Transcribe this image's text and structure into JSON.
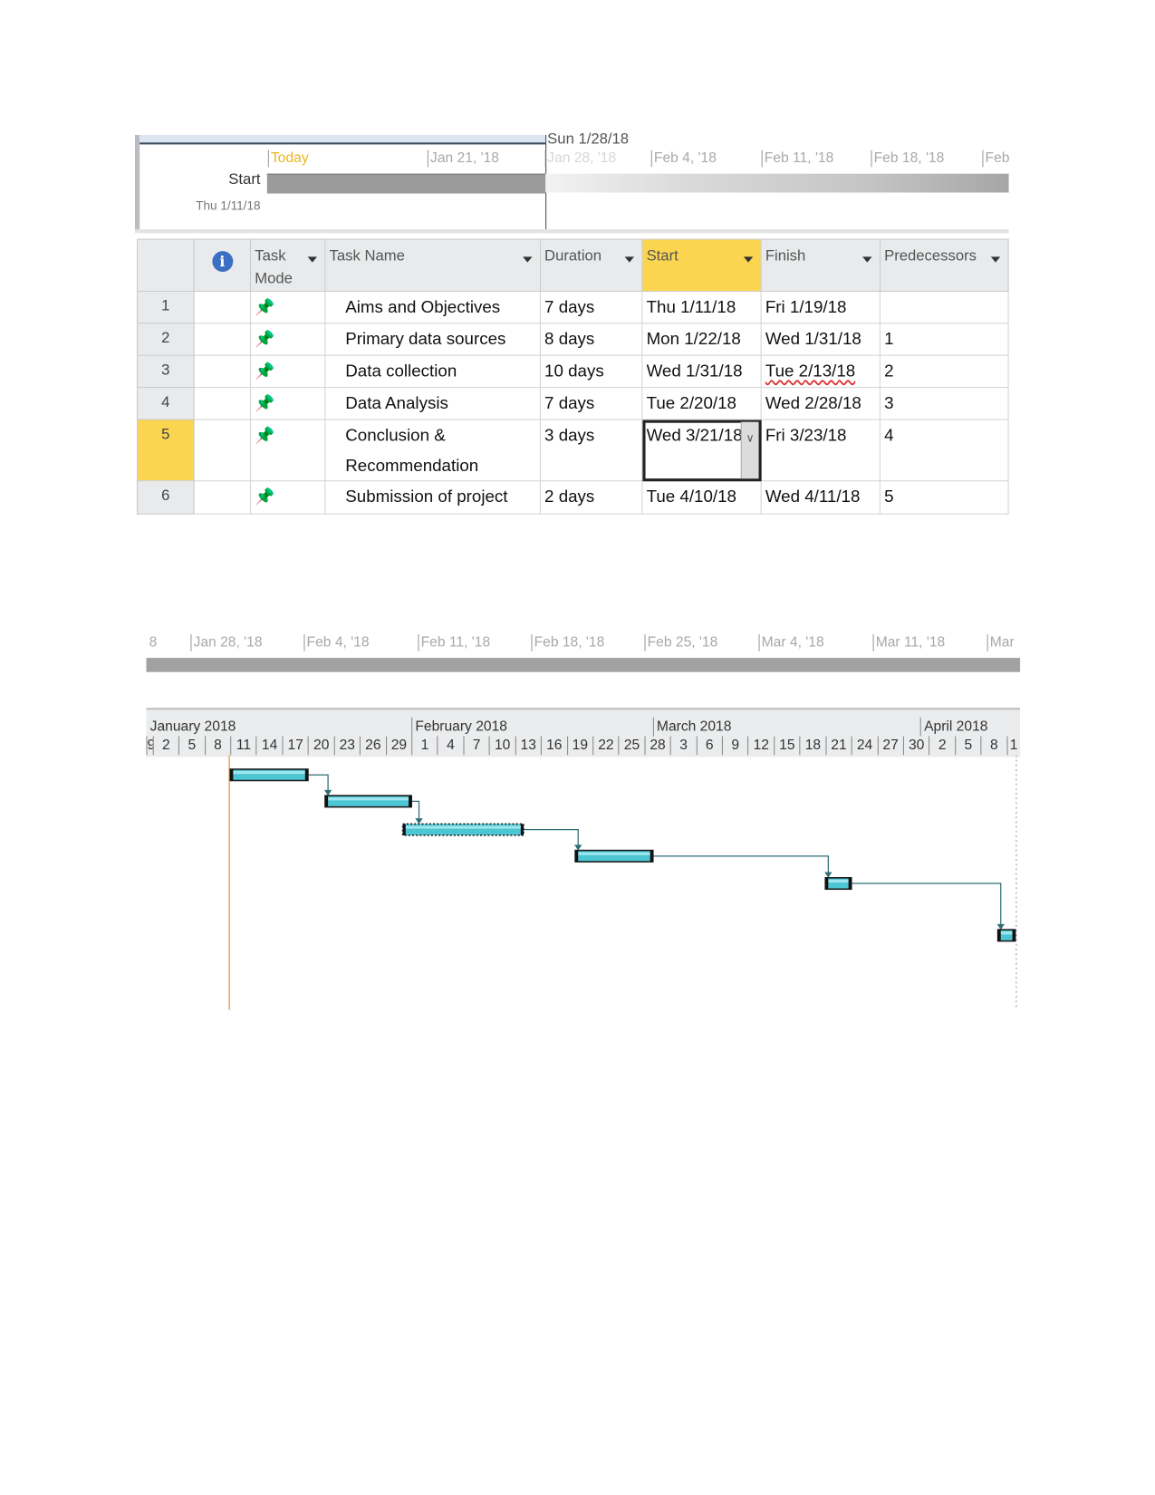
{
  "top_timeline": {
    "current_date_label": "Sun 1/28/18",
    "today_label": "Today",
    "ticks": [
      "Jan 21, '18",
      "Jan 28, '18",
      "Feb 4, '18",
      "Feb 11, '18",
      "Feb 18, '18",
      "Feb"
    ],
    "start_label": "Start",
    "start_date": "Thu 1/11/18"
  },
  "table": {
    "headers": {
      "info_icon": "info-icon",
      "task_mode": "Task Mode",
      "task_mode_line1": "Task",
      "task_mode_line2": "Mode",
      "task_name": "Task Name",
      "duration": "Duration",
      "start": "Start",
      "finish": "Finish",
      "predecessors": "Predecessors"
    },
    "selected_row": 5,
    "highlight_color": "#fbd550",
    "rows": [
      {
        "id": "1",
        "mode_icon": "manual-pin-icon",
        "name": "Aims and Objectives",
        "duration": "7 days",
        "start": "Thu 1/11/18",
        "finish": "Fri 1/19/18",
        "predecessors": ""
      },
      {
        "id": "2",
        "mode_icon": "manual-pin-icon",
        "name": "Primary data sources",
        "duration": "8 days",
        "start": "Mon 1/22/18",
        "finish": "Wed 1/31/18",
        "predecessors": "1"
      },
      {
        "id": "3",
        "mode_icon": "manual-pin-icon",
        "name": "Data collection",
        "duration": "10 days",
        "start": "Wed 1/31/18",
        "finish": "Tue 2/13/18",
        "predecessors": "2"
      },
      {
        "id": "4",
        "mode_icon": "manual-pin-icon",
        "name": "Data Analysis",
        "duration": "7 days",
        "start": "Tue 2/20/18",
        "finish": "Wed 2/28/18",
        "predecessors": "3"
      },
      {
        "id": "5",
        "mode_icon": "manual-pin-icon",
        "name": "Conclusion & Recommendation",
        "name_line1": "Conclusion &",
        "name_line2": "Recommendation",
        "duration": "3 days",
        "start": "Wed 3/21/18",
        "finish": "Fri 3/23/18",
        "predecessors": "4"
      },
      {
        "id": "6",
        "mode_icon": "manual-pin-icon",
        "name": "Submission of project",
        "duration": "2 days",
        "start": "Tue 4/10/18",
        "finish": "Wed 4/11/18",
        "predecessors": "5"
      }
    ]
  },
  "second_timeline": {
    "ticks": [
      "8",
      "Jan 28, '18",
      "Feb 4, '18",
      "Feb 11, '18",
      "Feb 18, '18",
      "Feb 25, '18",
      "Mar 4, '18",
      "Mar 11, '18",
      "Mar"
    ]
  },
  "gantt": {
    "bar_color": "#4cc6d3",
    "link_color": "#2f6f73",
    "today_line_color": "#e8a860",
    "months": [
      "January 2018",
      "February 2018",
      "March 2018",
      "April 2018"
    ],
    "day_ticks": [
      "9",
      "2",
      "5",
      "8",
      "11",
      "14",
      "17",
      "20",
      "23",
      "26",
      "29",
      "1",
      "4",
      "7",
      "10",
      "13",
      "16",
      "19",
      "22",
      "25",
      "28",
      "3",
      "6",
      "9",
      "12",
      "15",
      "18",
      "21",
      "24",
      "27",
      "30",
      "2",
      "5",
      "8",
      "1"
    ],
    "bars": [
      {
        "task": "1",
        "start": "2018-01-11",
        "finish": "2018-01-19"
      },
      {
        "task": "2",
        "start": "2018-01-22",
        "finish": "2018-01-31"
      },
      {
        "task": "3",
        "start": "2018-01-31",
        "finish": "2018-02-13",
        "selected": true
      },
      {
        "task": "4",
        "start": "2018-02-20",
        "finish": "2018-02-28"
      },
      {
        "task": "5",
        "start": "2018-03-21",
        "finish": "2018-03-23"
      },
      {
        "task": "6",
        "start": "2018-04-10",
        "finish": "2018-04-11"
      }
    ]
  }
}
